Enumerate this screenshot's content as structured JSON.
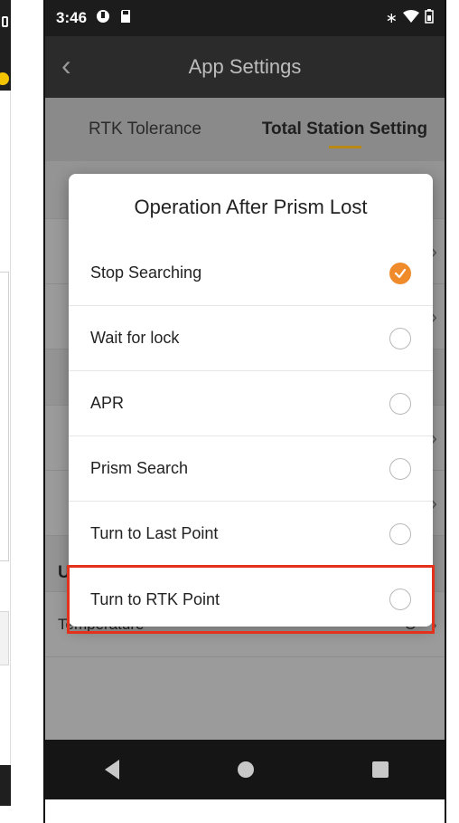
{
  "status": {
    "time": "3:46"
  },
  "appbar": {
    "title": "App Settings"
  },
  "tabs": [
    {
      "label": "RTK Tolerance",
      "active": false
    },
    {
      "label": "Total Station Setting",
      "active": true
    }
  ],
  "background_rows": {
    "unit_set": "Unit Set",
    "temperature_label": "Temperature",
    "temperature_value": "°C"
  },
  "dialog": {
    "title": "Operation After Prism Lost",
    "options": [
      {
        "label": "Stop Searching",
        "checked": true
      },
      {
        "label": "Wait for lock",
        "checked": false
      },
      {
        "label": "APR",
        "checked": false
      },
      {
        "label": "Prism Search",
        "checked": false
      },
      {
        "label": "Turn to Last Point",
        "checked": false
      },
      {
        "label": "Turn to RTK Point",
        "checked": false
      }
    ]
  },
  "colors": {
    "accent": "#f08b2c",
    "highlight_box": "#e3311b",
    "tab_indicator": "#b88914"
  }
}
